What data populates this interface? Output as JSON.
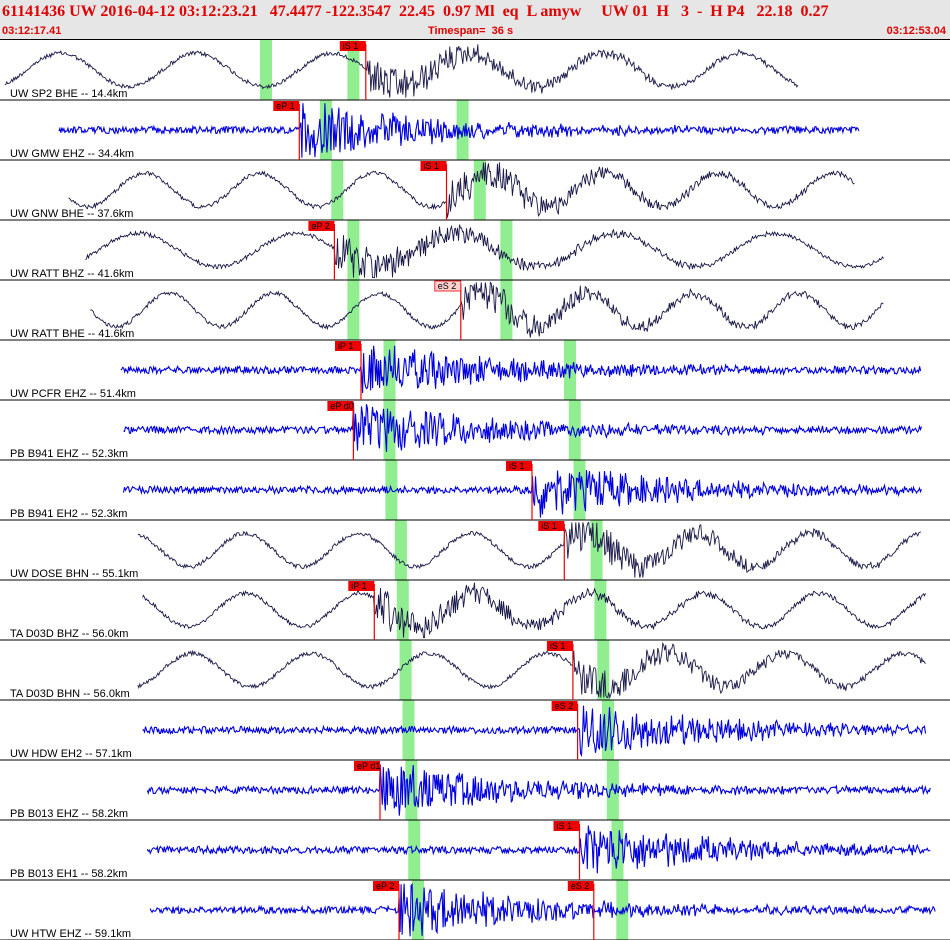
{
  "header": {
    "title": "61141436 UW 2016-04-12 03:12:23.21   47.4477 -122.3547  22.45  0.97 Ml  eq  L amyw     UW 01  H   3  -  H P4   22.18  0.27",
    "start_time": "03:12:17.41",
    "timespan": "Timespan=  36 s",
    "end_time": "03:12:53.04"
  },
  "colors": {
    "header_text": "#e00000",
    "trace_broadband": "#1a1a4a",
    "trace_short_period": "#0000e0",
    "pick_window": "#90ee90",
    "pick_flag": "#ee0000"
  },
  "channels": [
    {
      "label": "UW SP2 BHE -- 14.4km",
      "type": "bb",
      "start_frac": 0.005,
      "end_frac": 0.84,
      "picks": [
        {
          "label": "iS 1",
          "pos_frac": 0.385,
          "kind": "flag"
        }
      ],
      "windows": [
        0.28,
        0.372
      ]
    },
    {
      "label": "UW GMW EHZ -- 34.4km",
      "type": "sp",
      "start_frac": 0.062,
      "end_frac": 0.905,
      "picks": [
        {
          "label": "eP 1",
          "pos_frac": 0.315,
          "kind": "flag"
        }
      ],
      "windows": [
        0.343,
        0.487
      ]
    },
    {
      "label": "UW GNW BHE -- 37.6km",
      "type": "bb",
      "start_frac": 0.072,
      "end_frac": 0.9,
      "picks": [
        {
          "label": "iS 1",
          "pos_frac": 0.47,
          "kind": "flag"
        }
      ],
      "windows": [
        0.355,
        0.505
      ]
    },
    {
      "label": "UW RATT BHZ -- 41.6km",
      "type": "bb",
      "start_frac": 0.09,
      "end_frac": 0.93,
      "picks": [
        {
          "label": "eP 2",
          "pos_frac": 0.352,
          "kind": "flag"
        }
      ],
      "windows": [
        0.372,
        0.533
      ]
    },
    {
      "label": "UW RATT BHE -- 41.6km",
      "type": "bb",
      "start_frac": 0.095,
      "end_frac": 0.93,
      "picks": [
        {
          "label": "eS 2",
          "pos_frac": 0.485,
          "kind": "box"
        }
      ],
      "windows": [
        0.372,
        0.533
      ]
    },
    {
      "label": "UW PCFR EHZ -- 51.4km",
      "type": "sp",
      "start_frac": 0.127,
      "end_frac": 0.97,
      "picks": [
        {
          "label": "iP 1",
          "pos_frac": 0.38,
          "kind": "flag"
        }
      ],
      "windows": [
        0.41,
        0.6
      ]
    },
    {
      "label": "PB B941 EHZ -- 52.3km",
      "type": "sp",
      "start_frac": 0.13,
      "end_frac": 0.97,
      "picks": [
        {
          "label": "eP d0",
          "pos_frac": 0.372,
          "kind": "flag"
        }
      ],
      "windows": [
        0.41,
        0.605
      ]
    },
    {
      "label": "PB B941 EH2 -- 52.3km",
      "type": "sp",
      "start_frac": 0.13,
      "end_frac": 0.97,
      "picks": [
        {
          "label": "iS 1",
          "pos_frac": 0.56,
          "kind": "flag"
        }
      ],
      "windows": [
        0.412,
        0.61
      ]
    },
    {
      "label": "UW DOSE BHN -- 55.1km",
      "type": "bb",
      "start_frac": 0.145,
      "end_frac": 0.97,
      "picks": [
        {
          "label": "iS 1",
          "pos_frac": 0.594,
          "kind": "flag"
        }
      ],
      "windows": [
        0.422,
        0.628
      ]
    },
    {
      "label": "TA D03D BHZ -- 56.0km",
      "type": "bb",
      "start_frac": 0.15,
      "end_frac": 0.975,
      "picks": [
        {
          "label": "iP 1",
          "pos_frac": 0.394,
          "kind": "flag"
        }
      ],
      "windows": [
        0.424,
        0.632
      ]
    },
    {
      "label": "TA D03D BHN -- 56.0km",
      "type": "bb",
      "start_frac": 0.145,
      "end_frac": 0.975,
      "picks": [
        {
          "label": "iS 1",
          "pos_frac": 0.603,
          "kind": "flag"
        }
      ],
      "windows": [
        0.427,
        0.635
      ]
    },
    {
      "label": "UW HDW EH2 -- 57.1km",
      "type": "sp",
      "start_frac": 0.15,
      "end_frac": 0.975,
      "picks": [
        {
          "label": "eS 2",
          "pos_frac": 0.608,
          "kind": "flag"
        }
      ],
      "windows": [
        0.43,
        0.64
      ]
    },
    {
      "label": "PB B013 EHZ -- 58.2km",
      "type": "sp",
      "start_frac": 0.155,
      "end_frac": 0.98,
      "picks": [
        {
          "label": "eP d1",
          "pos_frac": 0.4,
          "kind": "flag"
        }
      ],
      "windows": [
        0.433,
        0.645
      ]
    },
    {
      "label": "PB B013 EH1 -- 58.2km",
      "type": "sp",
      "start_frac": 0.155,
      "end_frac": 0.98,
      "picks": [
        {
          "label": "iS 1",
          "pos_frac": 0.61,
          "kind": "flag"
        }
      ],
      "windows": [
        0.436,
        0.65
      ]
    },
    {
      "label": "UW HTW EHZ -- 59.1km",
      "type": "sp",
      "start_frac": 0.158,
      "end_frac": 0.985,
      "picks": [
        {
          "label": "eP 2",
          "pos_frac": 0.42,
          "kind": "flag"
        },
        {
          "label": "eS 2",
          "pos_frac": 0.625,
          "kind": "flag"
        }
      ],
      "windows": [
        0.44,
        0.655
      ]
    }
  ]
}
